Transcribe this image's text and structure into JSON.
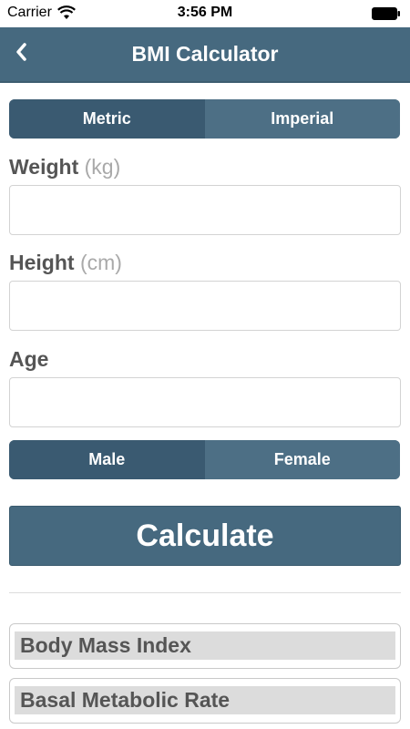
{
  "status_bar": {
    "carrier": "Carrier",
    "time": "3:56 PM"
  },
  "nav": {
    "title": "BMI Calculator",
    "back_icon": "chevron-left-icon",
    "background": "#46697f"
  },
  "unit_toggle": {
    "options": [
      "Metric",
      "Imperial"
    ],
    "selected": "Metric"
  },
  "fields": {
    "weight": {
      "label": "Weight",
      "unit": "(kg)",
      "value": ""
    },
    "height": {
      "label": "Height",
      "unit": "(cm)",
      "value": ""
    },
    "age": {
      "label": "Age",
      "value": ""
    }
  },
  "gender_toggle": {
    "options": [
      "Male",
      "Female"
    ],
    "selected": "Male"
  },
  "calculate_label": "Calculate",
  "results": {
    "bmi_label": "Body Mass Index",
    "bmr_label": "Basal Metabolic Rate"
  },
  "colors": {
    "accent": "#46697f",
    "segment_active": "#3a5a71",
    "label_text": "#555555",
    "unit_text": "#a9a9a9"
  }
}
